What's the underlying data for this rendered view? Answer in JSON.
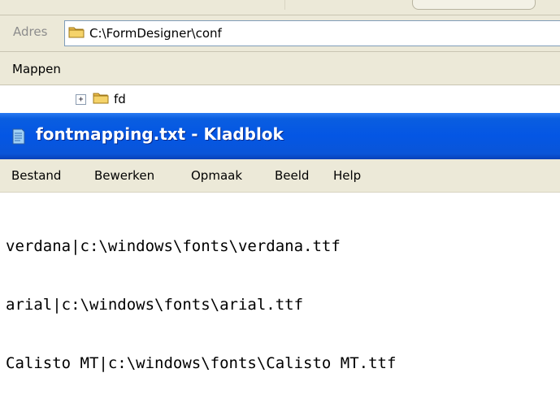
{
  "address_bar": {
    "label": "Adres",
    "path": "C:\\FormDesigner\\conf",
    "icon": "folder-icon"
  },
  "folders_pane": {
    "title": "Mappen",
    "tree": [
      {
        "label": "fd",
        "expander": "+",
        "icon": "folder-icon"
      }
    ]
  },
  "notepad": {
    "title": "fontmapping.txt - Kladblok",
    "icon": "notepad-icon",
    "menu": {
      "file": "Bestand",
      "edit": "Bewerken",
      "format": "Opmaak",
      "view": "Beeld",
      "help": "Help"
    },
    "lines": [
      "verdana|c:\\windows\\fonts\\verdana.ttf",
      "arial|c:\\windows\\fonts\\arial.ttf",
      "Calisto MT|c:\\windows\\fonts\\Calisto MT.ttf"
    ]
  },
  "colors": {
    "titlebar_blue": "#0456e4",
    "chrome_beige": "#ece9d8",
    "folder_yellow": "#f5d36a"
  }
}
